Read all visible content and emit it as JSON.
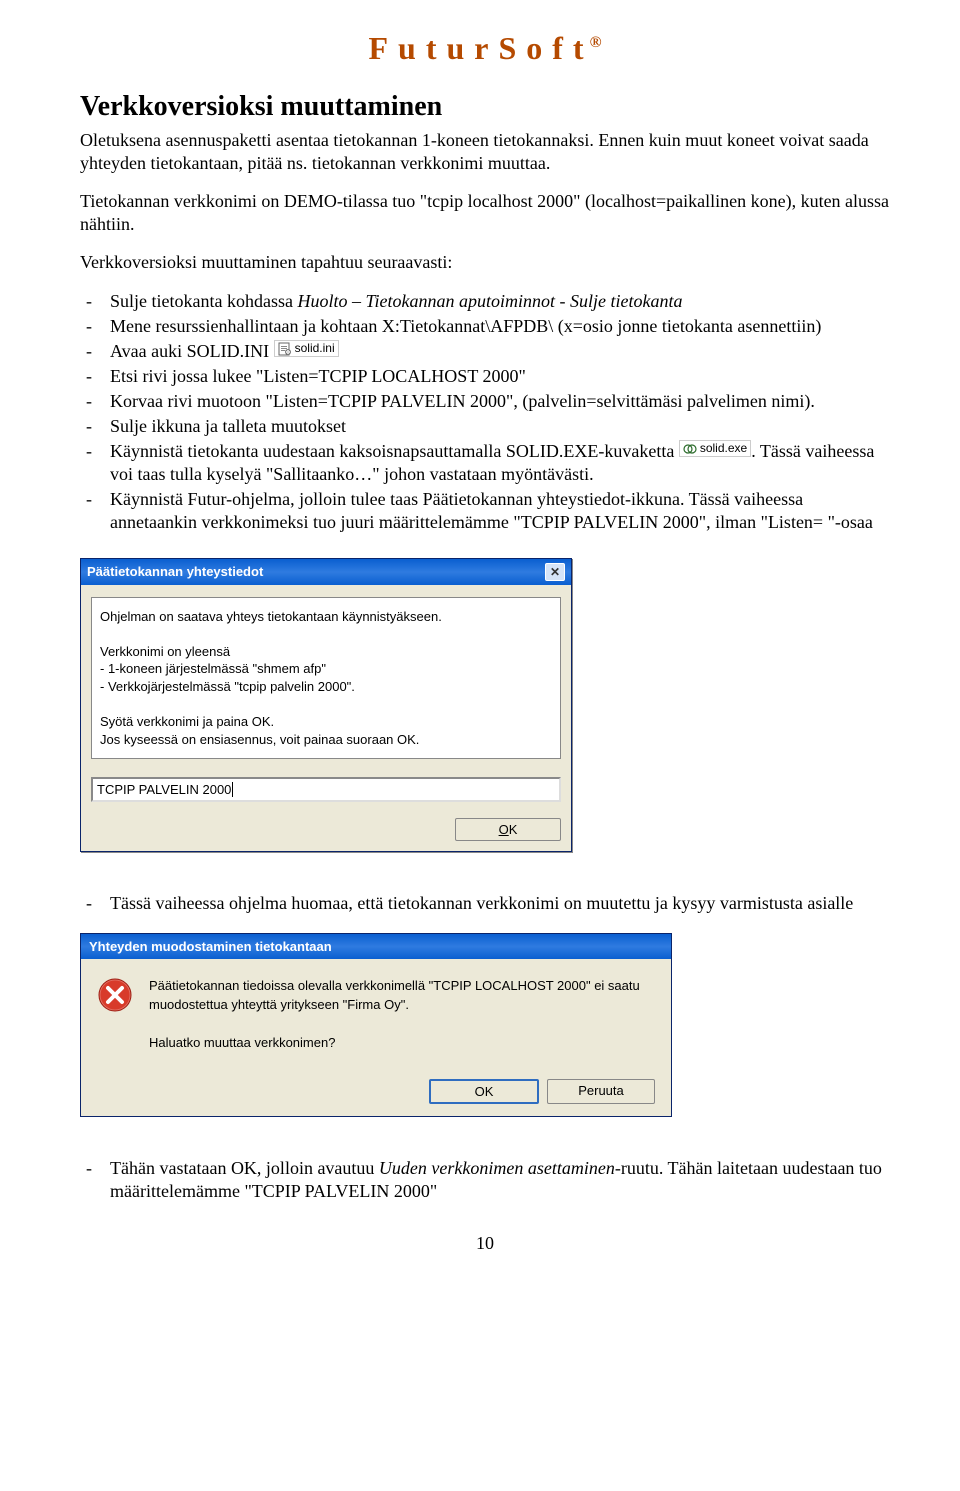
{
  "brand": "FuturSoft",
  "brand_sup": "®",
  "heading": "Verkkoversioksi muuttaminen",
  "p1": "Oletuksena asennuspaketti asentaa tietokannan 1-koneen tietokannaksi. Ennen kuin muut koneet voivat saada yhteyden tietokantaan, pitää ns. tietokannan verkkonimi muuttaa.",
  "p2": "Tietokannan verkkonimi on DEMO-tilassa tuo \"tcpip localhost 2000\" (localhost=paikallinen kone), kuten alussa nähtiin.",
  "p3": "Verkkoversioksi muuttaminen tapahtuu seuraavasti:",
  "bullets": {
    "b1a": "Sulje tietokanta kohdassa ",
    "b1i": "Huolto – Tietokannan aputoiminnot - Sulje tietokanta",
    "b2": "Mene resurssienhallintaan ja kohtaan X:Tietokannat\\AFPDB\\ (x=osio jonne tietokanta asennettiin)",
    "b3": "Avaa auki SOLID.INI",
    "b4": "Etsi rivi jossa lukee \"Listen=TCPIP LOCALHOST 2000\"",
    "b5": "Korvaa rivi muotoon \"Listen=TCPIP PALVELIN 2000\", (palvelin=selvittämäsi palvelimen nimi).",
    "b6": "Sulje ikkuna ja talleta muutokset",
    "b7a": "Käynnistä tietokanta uudestaan kaksoisnapsauttamalla SOLID.EXE-kuvaketta ",
    "b7b": ". Tässä vaiheessa voi taas tulla kyselyä \"Sallitaanko…\" johon vastataan myöntävästi.",
    "b8": "Käynnistä Futur-ohjelma, jolloin tulee taas Päätietokannan yhteystiedot-ikkuna. Tässä vaiheessa annetaankin verkkonimeksi tuo juuri määrittelemämme \"TCPIP PALVELIN 2000\", ilman \"Listen= \"-osaa"
  },
  "icons": {
    "solid_ini": "solid.ini",
    "solid_exe": "solid.exe"
  },
  "dialog1": {
    "title": "Päätietokannan yhteystiedot",
    "line1": "Ohjelman on saatava yhteys tietokantaan käynnistyäkseen.",
    "line2": "Verkkonimi on yleensä",
    "line3": "- 1-koneen järjestelmässä \"shmem afp\"",
    "line4": "- Verkkojärjestelmässä \"tcpip palvelin 2000\".",
    "line5": "Syötä verkkonimi ja paina OK.",
    "line6": "Jos kyseessä on ensiasennus, voit painaa suoraan OK.",
    "input_value": "TCPIP PALVELIN 2000",
    "ok_prefix": "O",
    "ok_suffix": "K"
  },
  "after_d1": "Tässä vaiheessa ohjelma huomaa, että tietokannan verkkonimi on muutettu ja kysyy varmistusta asialle",
  "dialog2": {
    "title": "Yhteyden muodostaminen tietokantaan",
    "msg1": "Päätietokannan tiedoissa olevalla verkkonimellä \"TCPIP LOCALHOST 2000\" ei saatu muodostettua yhteyttä yritykseen \"Firma Oy\".",
    "msg2": "Haluatko muuttaa verkkonimen?",
    "ok": "OK",
    "cancel": "Peruuta"
  },
  "after_d2a": "Tähän vastataan OK, jolloin avautuu ",
  "after_d2i": "Uuden verkkonimen asettaminen",
  "after_d2b": "-ruutu. Tähän laitetaan uudestaan tuo määrittelemämme \"TCPIP PALVELIN 2000\"",
  "page_number": "10"
}
